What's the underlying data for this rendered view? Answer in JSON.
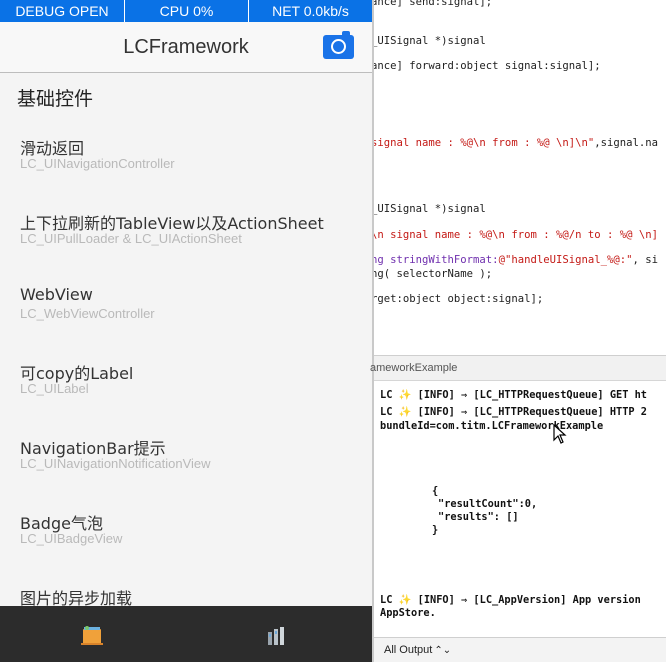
{
  "debug_bar": {
    "debug": "DEBUG OPEN",
    "cpu": "CPU 0%",
    "net": "NET 0.0kb/s",
    "color": "#0a72e6"
  },
  "nav": {
    "title": "LCFramework",
    "camera_icon": "camera-icon"
  },
  "section_header": "基础控件",
  "rows": [
    {
      "title": "滑动返回",
      "subtitle": "LC_UINavigationController"
    },
    {
      "title": "上下拉刷新的TableView以及ActionSheet",
      "subtitle": "LC_UIPullLoader & LC_UIActionSheet"
    },
    {
      "title": "WebView",
      "subtitle": "LC_WebViewController"
    },
    {
      "title": "可copy的Label",
      "subtitle": "LC_UILabel"
    },
    {
      "title": "NavigationBar提示",
      "subtitle": "LC_UINavigationNotificationView"
    },
    {
      "title": "Badge气泡",
      "subtitle": "LC_UIBadgeView"
    },
    {
      "title": "图片的异步加载",
      "subtitle": ""
    }
  ],
  "tab_bar": {
    "left_icon": "book-icon",
    "right_icon": "bars-icon"
  },
  "editor": {
    "lines": [
      {
        "parts": [
          {
            "t": "ance] send:signal];",
            "c": ""
          }
        ]
      },
      {
        "parts": [
          {
            "t": "_UISignal *)signal",
            "c": ""
          }
        ]
      },
      {
        "parts": [
          {
            "t": "ance] forward:object signal:signal];",
            "c": ""
          }
        ]
      },
      {
        "parts": [
          {
            "t": "signal name : %@\\n from : %@ \\n]\\n\"",
            "c": "red"
          },
          {
            "t": ",signal.na",
            "c": ""
          }
        ]
      },
      {
        "parts": [
          {
            "t": "_UISignal *)signal",
            "c": ""
          }
        ]
      },
      {
        "parts": [
          {
            "t": "\\n signal name : %@\\n from : %@/n to : %@ \\n]",
            "c": "red"
          }
        ]
      },
      {
        "parts": [
          {
            "t": "ng stringWithFormat:",
            "c": "pur"
          },
          {
            "t": "@\"handleUISignal_%@:\"",
            "c": "red"
          },
          {
            "t": ", si",
            "c": ""
          }
        ]
      },
      {
        "parts": [
          {
            "t": "ng( selectorName );",
            "c": ""
          }
        ]
      },
      {
        "parts": [
          {
            "t": "rget:object object:signal];",
            "c": ""
          }
        ]
      }
    ]
  },
  "console": {
    "target": "ameworkExample",
    "logs": [
      "LC ✨ [INFO] ⇒ [LC_HTTPRequestQueue] GET ht",
      "LC ✨ [INFO] ⇒ [LC_HTTPRequestQueue] HTTP 2",
      "bundleId=com.titm.LCFrameworkExample",
      "{",
      "\"resultCount\":0,",
      "\"results\": []",
      "}",
      "LC ✨ [INFO] ⇒ [LC_AppVersion] App version",
      "AppStore."
    ],
    "output_label": "All Output",
    "output_chevron": "⌃⌄"
  }
}
